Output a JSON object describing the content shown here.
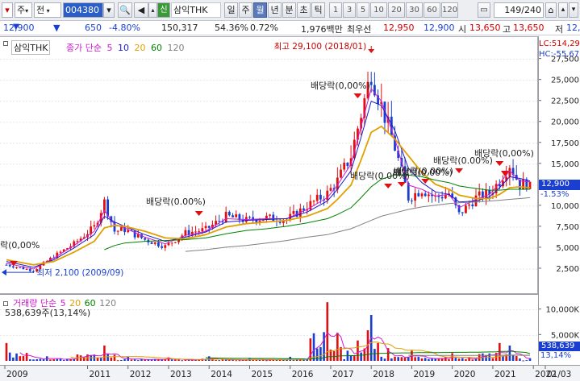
{
  "toolbar": {
    "market_sel": "주",
    "market_sel2": "전",
    "code": "004380",
    "badge": "신",
    "name": "삼익THK",
    "periods": [
      "일",
      "주",
      "월",
      "년",
      "분",
      "초",
      "틱"
    ],
    "active_period": "월",
    "nums": [
      "1",
      "3",
      "5",
      "10",
      "20",
      "30",
      "60",
      "120"
    ],
    "count": "149/240"
  },
  "info": {
    "price": "12,900",
    "change": "650",
    "change_pct": "-4.80%",
    "volume": "150,317",
    "ratio1": "54.36%",
    "ratio2": "0.72%",
    "amount": "1,976백만",
    "best_label": "최우선",
    "best_ask": "12,950",
    "best_bid": "12,900",
    "open_label": "시",
    "open": "13,650",
    "high_label": "고",
    "high": "13,650",
    "low_label": "저",
    "low": "12,"
  },
  "price_pane": {
    "name_tag": "삼익THK",
    "legend_label": "종가 단순",
    "ma_legend": [
      {
        "label": "5",
        "color": "#d01ad0"
      },
      {
        "label": "10",
        "color": "#1a1ad0"
      },
      {
        "label": "20",
        "color": "#e0a000"
      },
      {
        "label": "60",
        "color": "#008000"
      },
      {
        "label": "120",
        "color": "#808080"
      }
    ],
    "high_note": "최고 29,100 (2018/01)",
    "low_note": "최저 2,100 (2009/09)",
    "div_notes": [
      "배당락(0.00%)",
      "배당락(0,00%)",
      "배당락(0,00%)",
      "배당락(0.00%)",
      "배당락(0.00%)",
      "배당락(0.00%)",
      "배당락(0,00%)",
      "락(0,00%"
    ],
    "lc_label": "LC:514,29",
    "hc_label": "HC:-55,67",
    "last_price_label": "12,900",
    "last_change_label": "-1.53%"
  },
  "volume_pane": {
    "legend_label": "거래량 단순",
    "ma_legend": [
      {
        "label": "5",
        "color": "#d01ad0"
      },
      {
        "label": "20",
        "color": "#e0a000"
      },
      {
        "label": "60",
        "color": "#008000"
      },
      {
        "label": "120",
        "color": "#808080"
      }
    ],
    "current": "538,639주(13,14%)",
    "last_vol_label": "538,639",
    "last_pct_label": "13,14%"
  },
  "axis": {
    "dates": [
      "2009",
      "2011",
      "2012",
      "2013",
      "2014",
      "2015",
      "2016",
      "2017",
      "2018",
      "2019",
      "2020",
      "2021",
      "2022",
      "01/03"
    ]
  },
  "chart_data": [
    {
      "type": "candlestick",
      "title": "삼익THK",
      "interval": "monthly",
      "ylim": [
        0,
        29000
      ],
      "yticks": [
        2500,
        5000,
        7500,
        10000,
        12500,
        15000,
        17500,
        20000,
        22500,
        25000,
        27500
      ],
      "x_range": [
        "2009-01",
        "2021-12"
      ],
      "close_series": [
        {
          "t": "2009-01",
          "v": 3000
        },
        {
          "t": "2009-09",
          "v": 2300
        },
        {
          "t": "2010-03",
          "v": 4000
        },
        {
          "t": "2010-09",
          "v": 5500
        },
        {
          "t": "2011-03",
          "v": 7500
        },
        {
          "t": "2011-06",
          "v": 10500
        },
        {
          "t": "2011-09",
          "v": 7000
        },
        {
          "t": "2011-12",
          "v": 7200
        },
        {
          "t": "2012-06",
          "v": 6000
        },
        {
          "t": "2012-12",
          "v": 5200
        },
        {
          "t": "2013-06",
          "v": 6800
        },
        {
          "t": "2013-12",
          "v": 7200
        },
        {
          "t": "2014-06",
          "v": 8800
        },
        {
          "t": "2014-12",
          "v": 8300
        },
        {
          "t": "2015-06",
          "v": 8600
        },
        {
          "t": "2015-12",
          "v": 8400
        },
        {
          "t": "2016-06",
          "v": 10000
        },
        {
          "t": "2016-12",
          "v": 11500
        },
        {
          "t": "2017-03",
          "v": 13000
        },
        {
          "t": "2017-07",
          "v": 16000
        },
        {
          "t": "2017-10",
          "v": 21000
        },
        {
          "t": "2018-01",
          "v": 26000
        },
        {
          "t": "2018-04",
          "v": 22000
        },
        {
          "t": "2018-08",
          "v": 17000
        },
        {
          "t": "2018-12",
          "v": 11000
        },
        {
          "t": "2019-04",
          "v": 12000
        },
        {
          "t": "2019-08",
          "v": 11000
        },
        {
          "t": "2019-12",
          "v": 11500
        },
        {
          "t": "2020-03",
          "v": 9000
        },
        {
          "t": "2020-08",
          "v": 11000
        },
        {
          "t": "2020-12",
          "v": 11500
        },
        {
          "t": "2021-03",
          "v": 13000
        },
        {
          "t": "2021-06",
          "v": 15000
        },
        {
          "t": "2021-09",
          "v": 12500
        },
        {
          "t": "2021-12",
          "v": 12900
        }
      ],
      "series": [
        {
          "name": "5",
          "values": [
            3200,
            2500,
            3800,
            5300,
            7000,
            9500,
            7800,
            7400,
            6300,
            5500,
            6500,
            7000,
            8500,
            8400,
            8500,
            8500,
            9600,
            11000,
            12500,
            15000,
            19500,
            24000,
            22500,
            18000,
            12500,
            12000,
            11200,
            11400,
            9800,
            10800,
            11400,
            12700,
            14200,
            13000,
            12900
          ]
        },
        {
          "name": "10",
          "values": [
            3400,
            2700,
            3600,
            5000,
            6600,
            8800,
            8100,
            7600,
            6600,
            5800,
            6300,
            6900,
            8100,
            8300,
            8400,
            8500,
            9300,
            10600,
            12000,
            14200,
            18200,
            22500,
            22000,
            19000,
            14500,
            12800,
            11700,
            11400,
            10500,
            10600,
            11100,
            12200,
            13500,
            13300,
            13000
          ]
        },
        {
          "name": "20",
          "values": [
            3600,
            3000,
            3400,
            4500,
            5800,
            7400,
            7700,
            7600,
            7000,
            6200,
            6100,
            6600,
            7500,
            7900,
            8100,
            8300,
            8800,
            9700,
            10800,
            12500,
            15500,
            18800,
            19500,
            18000,
            16000,
            14000,
            12600,
            12000,
            11300,
            10900,
            10900,
            11400,
            12200,
            12300,
            12200
          ]
        },
        {
          "name": "60",
          "values": [
            null,
            null,
            null,
            null,
            null,
            4800,
            5300,
            5600,
            5800,
            5900,
            6000,
            6200,
            6700,
            7100,
            7300,
            7600,
            8000,
            8500,
            9000,
            9800,
            11000,
            12300,
            13200,
            13700,
            13700,
            13500,
            13100,
            12800,
            12400,
            12100,
            11900,
            11900,
            12000,
            12000,
            12000
          ]
        },
        {
          "name": "120",
          "values": [
            null,
            null,
            null,
            null,
            null,
            null,
            null,
            null,
            null,
            null,
            4600,
            4800,
            5100,
            5300,
            5600,
            5900,
            6300,
            6600,
            6900,
            7300,
            7800,
            8300,
            8800,
            9200,
            9600,
            9900,
            10100,
            10300,
            10400,
            10500,
            10600,
            10700,
            10800,
            10900,
            11000
          ]
        }
      ],
      "annotations": [
        {
          "text": "최고 29,100 (2018/01)",
          "x": "2018-01",
          "y": 29100
        },
        {
          "text": "최저 2,100 (2009/09)",
          "x": "2009-09",
          "y": 2100
        }
      ]
    },
    {
      "type": "bar",
      "title": "거래량",
      "ylim": [
        0,
        12000000
      ],
      "yticks": [
        5000000,
        10000000
      ],
      "latest": 538639,
      "values_sample": [
        {
          "t": "2009",
          "v": 3500000
        },
        {
          "t": "2010",
          "v": 900000
        },
        {
          "t": "2011-06",
          "v": 3000000
        },
        {
          "t": "2012",
          "v": 800000
        },
        {
          "t": "2013",
          "v": 700000
        },
        {
          "t": "2014",
          "v": 900000
        },
        {
          "t": "2015",
          "v": 600000
        },
        {
          "t": "2016",
          "v": 800000
        },
        {
          "t": "2016-12",
          "v": 11500000
        },
        {
          "t": "2017-03",
          "v": 5500000
        },
        {
          "t": "2017-06",
          "v": 2000000
        },
        {
          "t": "2017-09",
          "v": 4000000
        },
        {
          "t": "2017-12",
          "v": 6000000
        },
        {
          "t": "2018-01",
          "v": 9000000
        },
        {
          "t": "2018-03",
          "v": 3500000
        },
        {
          "t": "2018-06",
          "v": 2500000
        },
        {
          "t": "2019",
          "v": 2000000
        },
        {
          "t": "2020",
          "v": 1500000
        },
        {
          "t": "2021-03",
          "v": 3500000
        },
        {
          "t": "2021-06",
          "v": 3000000
        },
        {
          "t": "2021-12",
          "v": 538639
        }
      ]
    }
  ]
}
